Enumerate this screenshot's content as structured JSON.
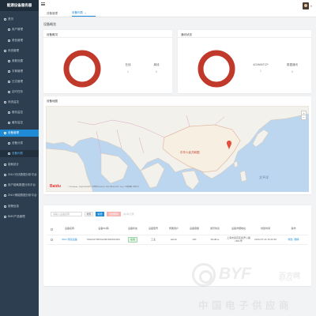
{
  "app": {
    "title": "能源设备服务器"
  },
  "sidebar": {
    "items": [
      {
        "label": "首页",
        "kind": "top"
      },
      {
        "label": "用户管理",
        "kind": "sub"
      },
      {
        "label": "角色管理",
        "kind": "sub"
      },
      {
        "label": "系统管理",
        "kind": "top"
      },
      {
        "label": "参数设置",
        "kind": "sub"
      },
      {
        "label": "字典管理",
        "kind": "sub"
      },
      {
        "label": "日志管理",
        "kind": "sub"
      },
      {
        "label": "定时任务",
        "kind": "sub"
      },
      {
        "label": "系统监控",
        "kind": "top"
      },
      {
        "label": "服务监控",
        "kind": "sub"
      },
      {
        "label": "缓存监控",
        "kind": "sub"
      },
      {
        "label": "设备管理",
        "kind": "top-active"
      },
      {
        "label": "设备分类",
        "kind": "sub"
      },
      {
        "label": "设备列表",
        "kind": "sub-selected"
      },
      {
        "label": "能耗统计",
        "kind": "top"
      },
      {
        "label": "ZNLY光伏数据分析平台",
        "kind": "top"
      },
      {
        "label": "用户能耗数据分析平台",
        "kind": "top"
      },
      {
        "label": "ZNLY储能数据分析平台",
        "kind": "top"
      },
      {
        "label": "报警信息",
        "kind": "top"
      },
      {
        "label": "BMS产品管理",
        "kind": "top"
      }
    ]
  },
  "topbar": {
    "tabs": [
      {
        "label": "设备管理"
      },
      {
        "label": "设备列表"
      }
    ],
    "tab_close_glyph": "×",
    "user_chevron": "▾"
  },
  "page": {
    "title": "设备概览"
  },
  "summary_cards": [
    {
      "title": "设备概况",
      "ring_color": "#c0392b",
      "stats": [
        {
          "label": "在线",
          "value": "1"
        },
        {
          "label": "离线",
          "value": "0"
        }
      ]
    },
    {
      "title": "通讯状态",
      "ring_color": "#c0392b",
      "stats": [
        {
          "label": "4G/Wifi/TCP",
          "value": "1"
        },
        {
          "label": "数据通讯",
          "value": "0"
        }
      ]
    }
  ],
  "map": {
    "title": "设备地图",
    "country_label": "中华人民共和国",
    "ocean_label": "太平洋",
    "logo": "Baidu",
    "attribution": "© 2024 Baidu - GS(2023)3206号 - 甲测资字1100930 - 京ICP证030173号 - Data © 百度智图, 长地万方",
    "zoom_in": "+",
    "zoom_out": "−",
    "marker_color": "#e74c3c"
  },
  "table": {
    "search_placeholder": "请输入设备名称",
    "search_button": "搜索",
    "add_button": "新增",
    "delete_button": "批量删除",
    "pager_text": "共1条记录",
    "headers": [
      "设备名称",
      "设备SN码",
      "设备状态",
      "设备型号",
      "所属用户",
      "设备容量",
      "通讯协议",
      "设备详细地址",
      "创建时间",
      "操作"
    ],
    "rows": [
      {
        "name": "ZNLY测试设备",
        "sn": "WH2017050412001030102404",
        "status": "在线",
        "model": "工业",
        "owner": "admin",
        "capacity": "10K",
        "protocol": "Modbus",
        "address": "上海市嘉定区嘉罗公路1661号",
        "created": "2019-07-16 15:40:46",
        "actions": [
          "修改",
          "删除"
        ]
      }
    ]
  },
  "watermark": {
    "en": "BYF",
    "cn_small": "百方网",
    "cn_small2": "byf.com",
    "cn": "中国电子供应商"
  }
}
